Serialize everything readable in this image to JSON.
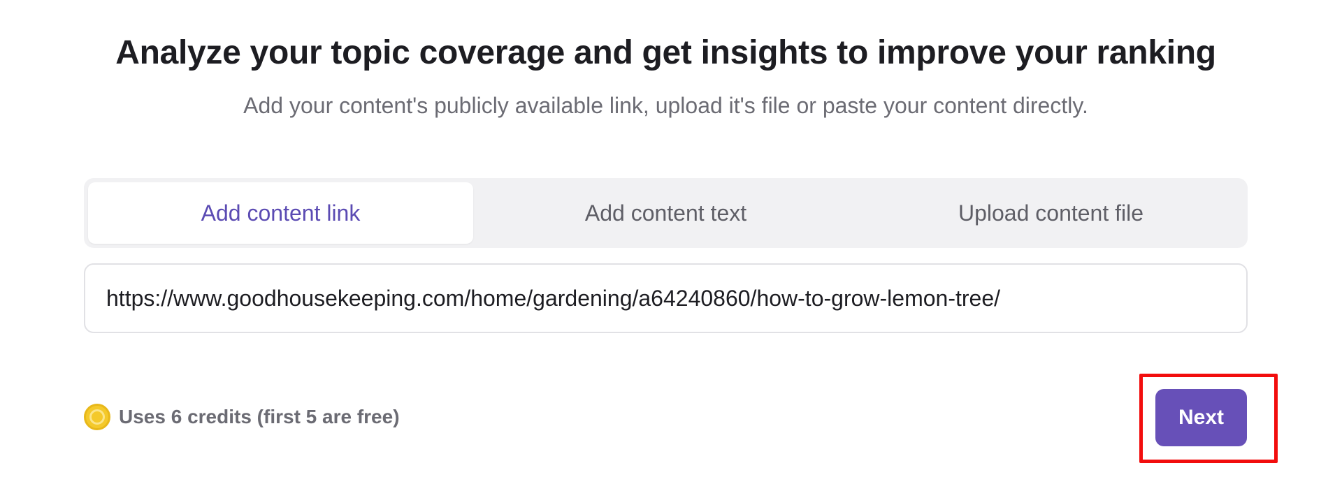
{
  "header": {
    "title": "Analyze your topic coverage and get insights to improve your ranking",
    "subtitle": "Add your content's publicly available link, upload it's file or paste your content directly."
  },
  "tabs": [
    {
      "label": "Add content link",
      "active": true
    },
    {
      "label": "Add content text",
      "active": false
    },
    {
      "label": "Upload content file",
      "active": false
    }
  ],
  "url_input": {
    "value": "https://www.goodhousekeeping.com/home/gardening/a64240860/how-to-grow-lemon-tree/"
  },
  "credits": {
    "icon": "coin-icon",
    "text": "Uses 6 credits (first 5 are free)"
  },
  "actions": {
    "next_label": "Next"
  },
  "colors": {
    "accent": "#6750b8",
    "active_tab_text": "#5b4bb3",
    "highlight": "#f20d0d",
    "coin": "#f4c92b"
  }
}
